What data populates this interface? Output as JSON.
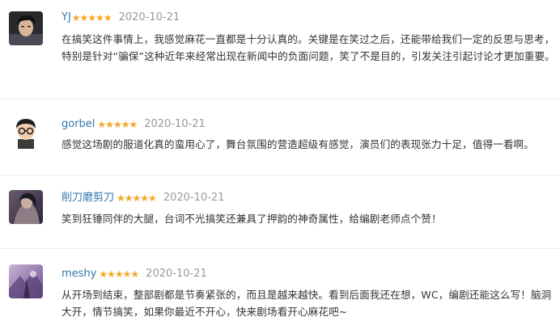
{
  "comments": [
    {
      "user": "YJ",
      "rating": 5,
      "stars": "★★★★★",
      "date": "2020-10-21",
      "text": "在搞笑这件事情上，我感觉麻花一直都是十分认真的。关键是在笑过之后，还能带给我们一定的反思与思考，特别是针对“骗保”这种近年来经常出现在新闻中的负面问题，笑了不是目的，引发关注引起讨论才更加重要。"
    },
    {
      "user": "gorbel",
      "rating": 5,
      "stars": "★★★★★",
      "date": "2020-10-21",
      "text": "感觉这场剧的服道化真的蛮用心了，舞台氛围的营造超级有感觉，演员们的表现张力十足，值得一看啊。"
    },
    {
      "user": "削刀磨剪刀",
      "rating": 5,
      "stars": "★★★★★",
      "date": "2020-10-21",
      "text": "笑到狂锤同伴的大腿，台词不光搞笑还兼具了押韵的神奇属性，给编剧老师点个赞！"
    },
    {
      "user": "meshy",
      "rating": 5,
      "stars": "★★★★★",
      "date": "2020-10-21",
      "text": "从开场到结束，整部剧都是节奏紧张的，而且是越来越快。看到后面我还在想，WC，编剧还能这么写！脑洞大开，情节搞笑，如果你最近不开心，快来剧场看开心麻花吧~"
    }
  ],
  "colors": {
    "username": "#3377aa",
    "star": "#f6a623",
    "date": "#999999",
    "text": "#333333",
    "divider": "#ececec"
  }
}
